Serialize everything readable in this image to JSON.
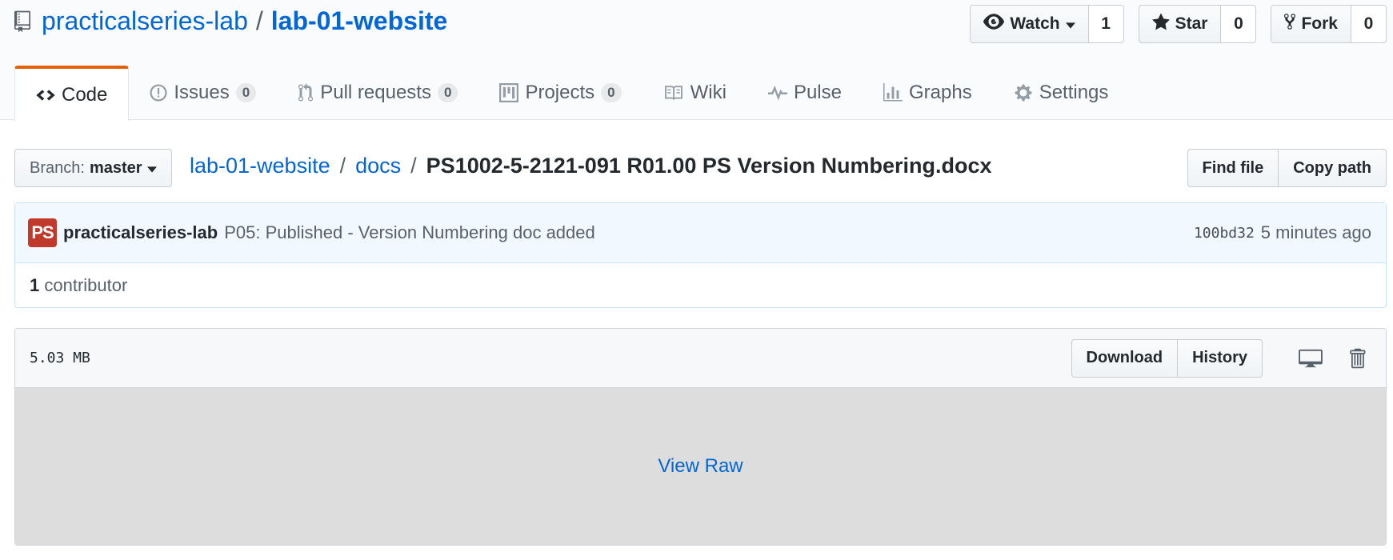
{
  "repo": {
    "owner": "practicalseries-lab",
    "separator": "/",
    "name": "lab-01-website"
  },
  "actions": {
    "watch": {
      "label": "Watch",
      "count": "1"
    },
    "star": {
      "label": "Star",
      "count": "0"
    },
    "fork": {
      "label": "Fork",
      "count": "0"
    }
  },
  "tabs": [
    {
      "label": "Code",
      "icon": "code-icon"
    },
    {
      "label": "Issues",
      "counter": "0",
      "icon": "issue-opened-icon"
    },
    {
      "label": "Pull requests",
      "counter": "0",
      "icon": "git-pull-request-icon"
    },
    {
      "label": "Projects",
      "counter": "0",
      "icon": "project-icon"
    },
    {
      "label": "Wiki",
      "icon": "book-icon"
    },
    {
      "label": "Pulse",
      "icon": "pulse-icon"
    },
    {
      "label": "Graphs",
      "icon": "graph-icon"
    },
    {
      "label": "Settings",
      "icon": "gear-icon"
    }
  ],
  "breadcrumb": {
    "branch_label": "Branch:",
    "branch_value": "master",
    "repo": "lab-01-website",
    "folder": "docs",
    "separator": "/",
    "file": "PS1002-5-2121-091 R01.00 PS Version Numbering.docx",
    "find_file": "Find file",
    "copy_path": "Copy path"
  },
  "commit": {
    "avatar_text": "PS",
    "author": "practicalseries-lab",
    "message": "P05: Published - Version Numbering doc added",
    "sha": "100bd32",
    "time": "5 minutes ago",
    "contributors_count": "1",
    "contributors_label": "contributor"
  },
  "file": {
    "size": "5.03 MB",
    "download": "Download",
    "history": "History",
    "view_raw": "View Raw"
  },
  "colors": {
    "link": "#0366d6",
    "tab_accent": "#e36209",
    "avatar_bg": "#c0392b",
    "commit_bg": "#f1f8ff",
    "raw_bg": "#dddddd"
  }
}
